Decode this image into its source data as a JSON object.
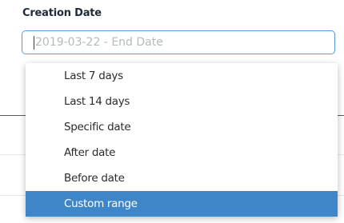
{
  "filter": {
    "label": "Creation Date",
    "input_value": "2019-03-22 - End Date"
  },
  "dropdown": {
    "options": [
      "Last 7 days",
      "Last 14 days",
      "Specific date",
      "After date",
      "Before date",
      "Custom range"
    ],
    "selected": "Custom range"
  },
  "colors": {
    "input_border": "#5b9bd5",
    "selected_bg": "#3f86c8",
    "selected_text": "#ffffff"
  }
}
